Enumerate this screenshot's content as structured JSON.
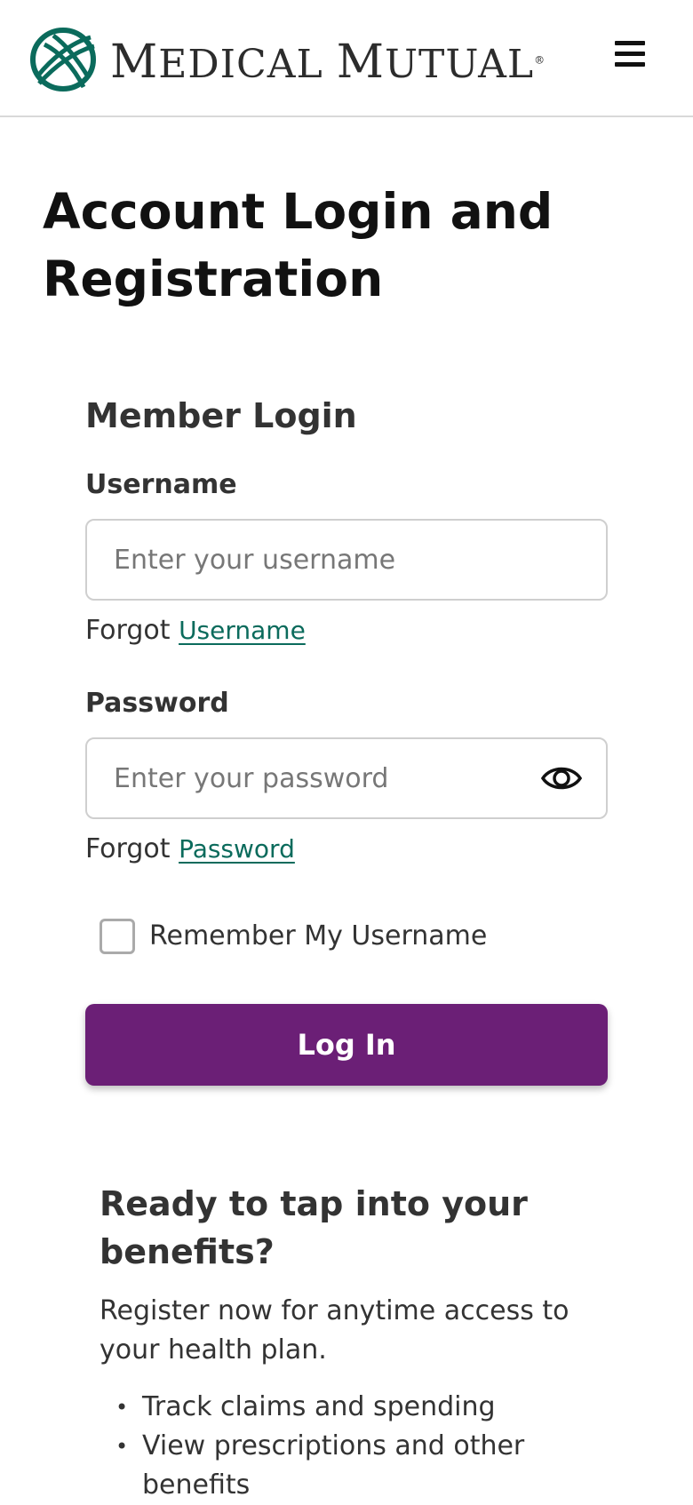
{
  "header": {
    "logo_text": "Medical Mutual",
    "logo_icon": "medical-mutual-logo-icon",
    "menu_icon": "hamburger-menu-icon"
  },
  "page": {
    "title": "Account Login and Registration"
  },
  "login": {
    "title": "Member Login",
    "username_label": "Username",
    "username_placeholder": "Enter your username",
    "username_value": "",
    "forgot_prefix": "Forgot",
    "forgot_username_link": "Username",
    "password_label": "Password",
    "password_placeholder": "Enter your password",
    "password_value": "",
    "eye_icon": "eye-icon",
    "forgot_password_link": "Password",
    "remember_label": "Remember My Username",
    "remember_checked": false,
    "login_button": "Log In"
  },
  "benefits": {
    "title": "Ready to tap into your benefits?",
    "text": "Register now for anytime access to your health plan.",
    "items": [
      "Track claims and spending",
      "View prescriptions and other benefits"
    ]
  },
  "colors": {
    "brand_teal": "#0b6b5c",
    "button_purple": "#6b1f76"
  }
}
